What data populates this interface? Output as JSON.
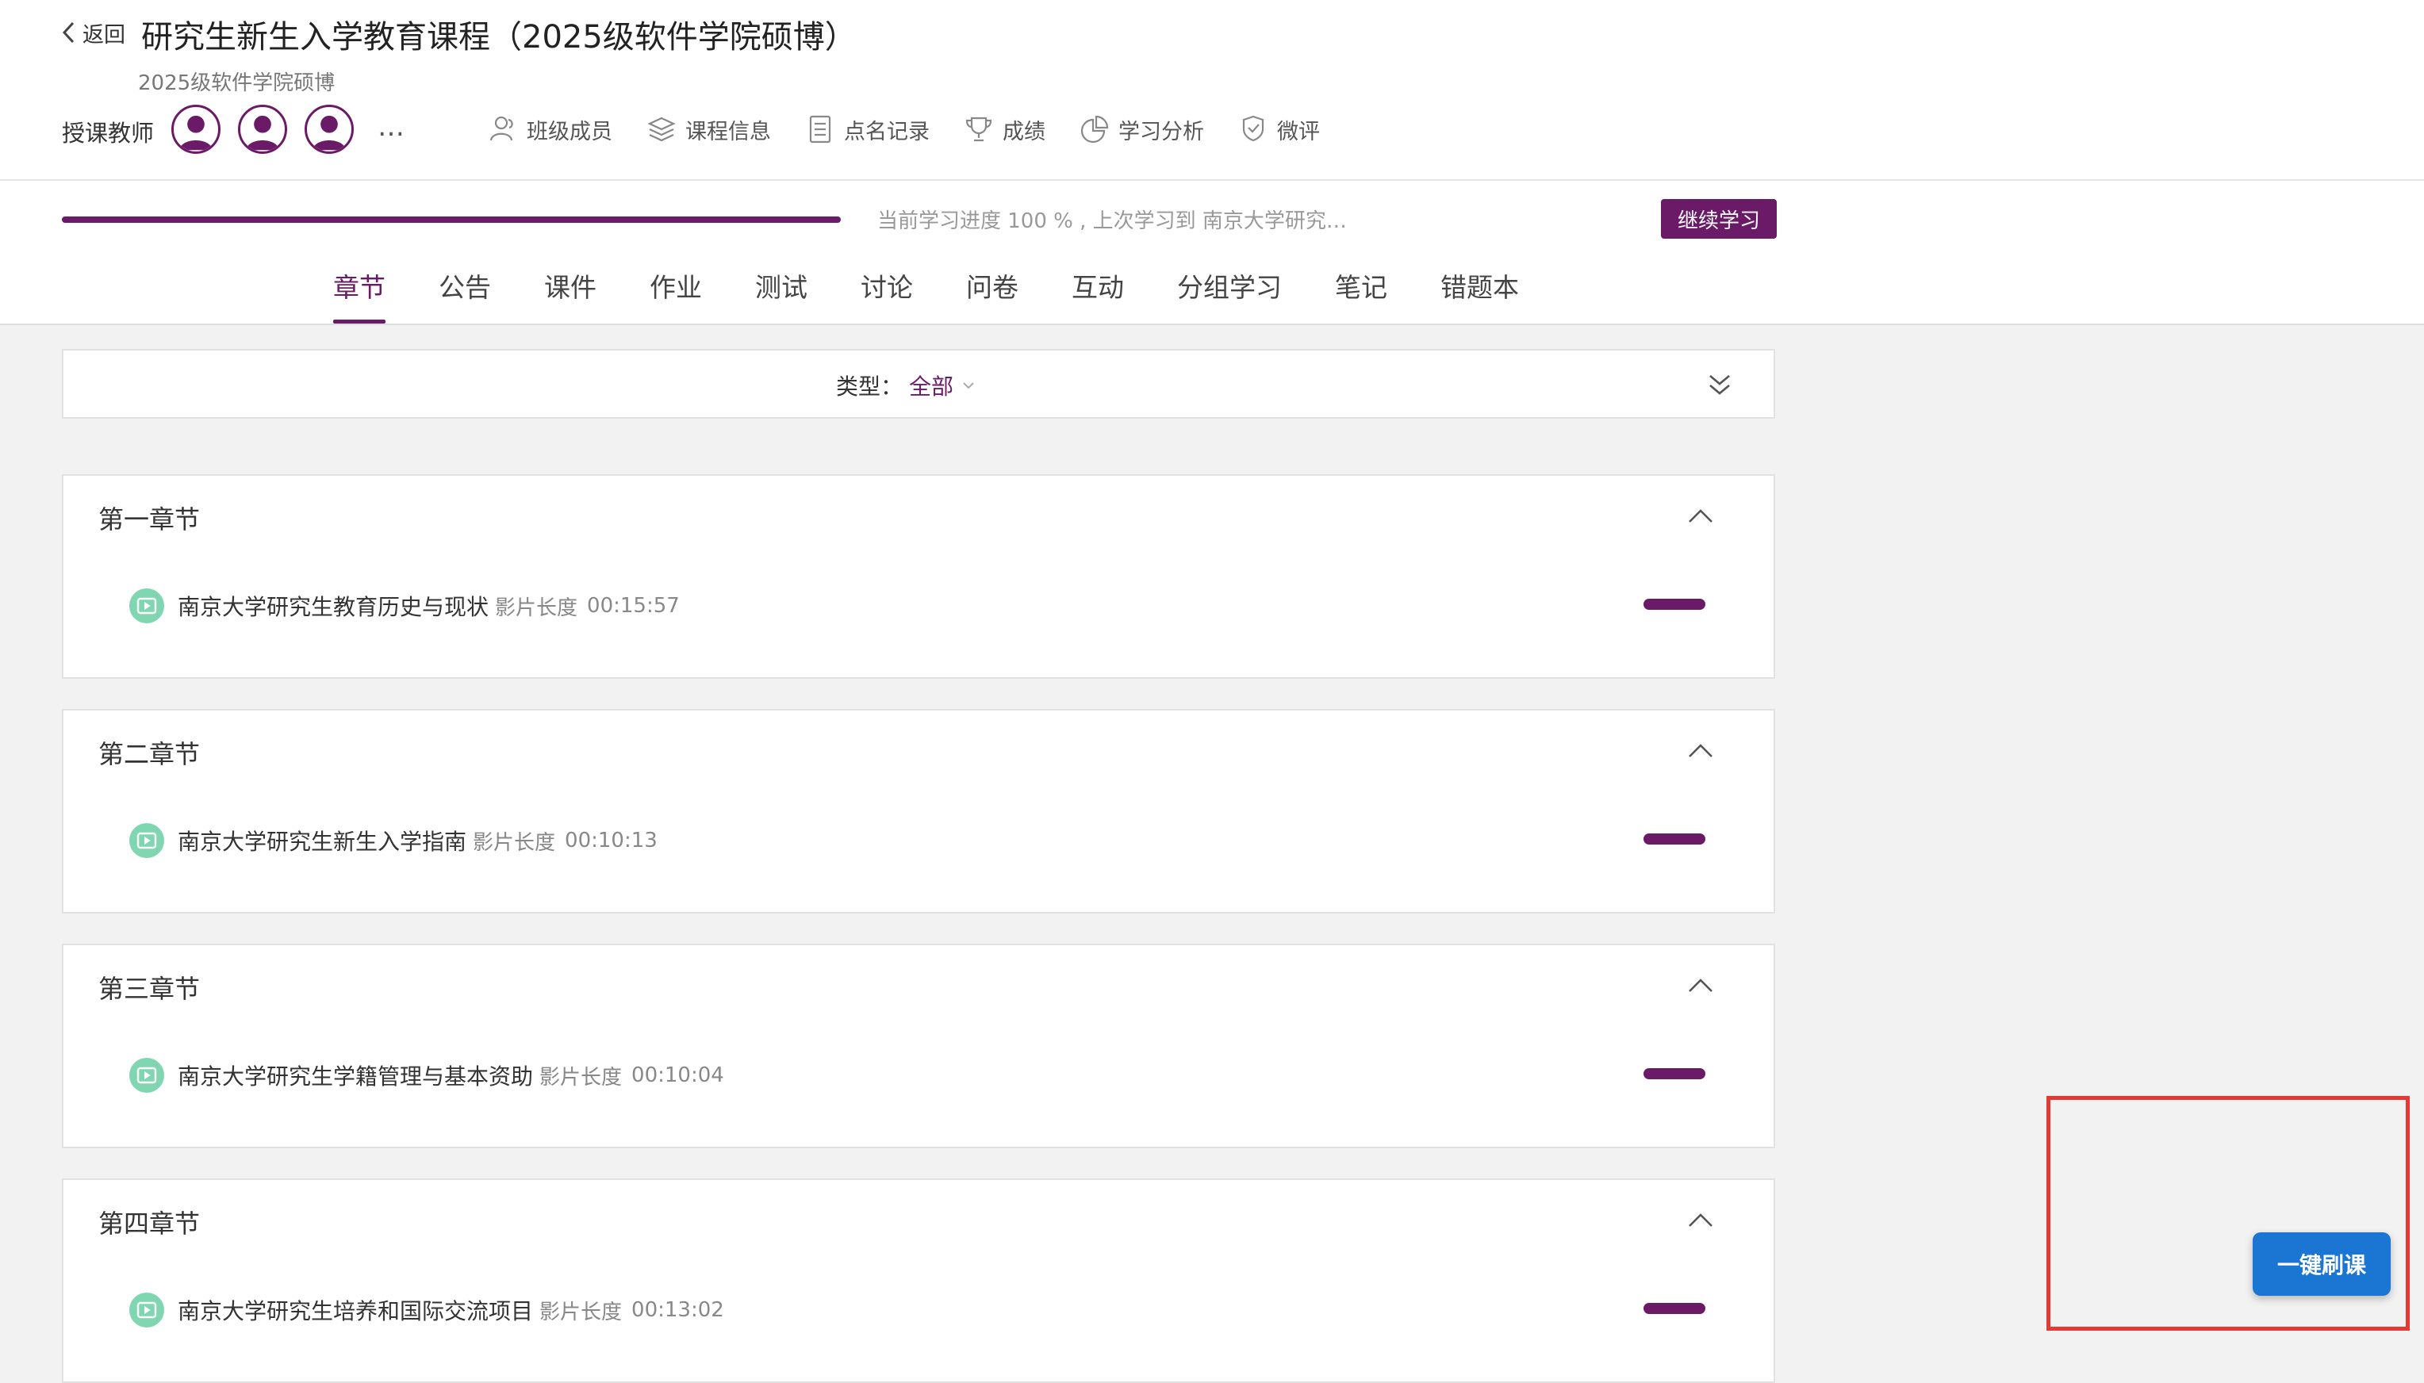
{
  "header": {
    "back_label": "返回",
    "course_title": "研究生新生入学教育课程（2025级软件学院硕博）",
    "course_subtitle": "2025级软件学院硕博",
    "teacher_label": "授课教师",
    "more_label": "…"
  },
  "toolbar": [
    {
      "label": "班级成员",
      "icon": "members-icon"
    },
    {
      "label": "课程信息",
      "icon": "layers-icon"
    },
    {
      "label": "点名记录",
      "icon": "document-icon"
    },
    {
      "label": "成绩",
      "icon": "trophy-icon"
    },
    {
      "label": "学习分析",
      "icon": "pie-chart-icon"
    },
    {
      "label": "微评",
      "icon": "comment-badge-icon"
    }
  ],
  "progress": {
    "value": 1.0,
    "text": "当前学习进度 100 % , 上次学习到 南京大学研究…",
    "continue_label": "继续学习"
  },
  "tabs": [
    "章节",
    "公告",
    "课件",
    "作业",
    "测试",
    "讨论",
    "问卷",
    "互动",
    "分组学习",
    "笔记",
    "错题本"
  ],
  "active_tab": "章节",
  "filter": {
    "label": "类型：",
    "value": "全部"
  },
  "chapters": [
    {
      "title": "第一章节",
      "lesson": "南京大学研究生教育历史与现状",
      "meta": "影片长度",
      "duration": "00:15:57"
    },
    {
      "title": "第二章节",
      "lesson": "南京大学研究生新生入学指南",
      "meta": "影片长度",
      "duration": "00:10:13"
    },
    {
      "title": "第三章节",
      "lesson": "南京大学研究生学籍管理与基本资助",
      "meta": "影片长度",
      "duration": "00:10:04"
    },
    {
      "title": "第四章节",
      "lesson": "南京大学研究生培养和国际交流项目",
      "meta": "影片长度",
      "duration": "00:13:02"
    }
  ],
  "floating_button": "一键刷课",
  "colors": {
    "brand": "#6b1a68",
    "video_icon": "#7fd6b0",
    "float_button": "#1a76d2",
    "highlight_box": "#e53935"
  }
}
